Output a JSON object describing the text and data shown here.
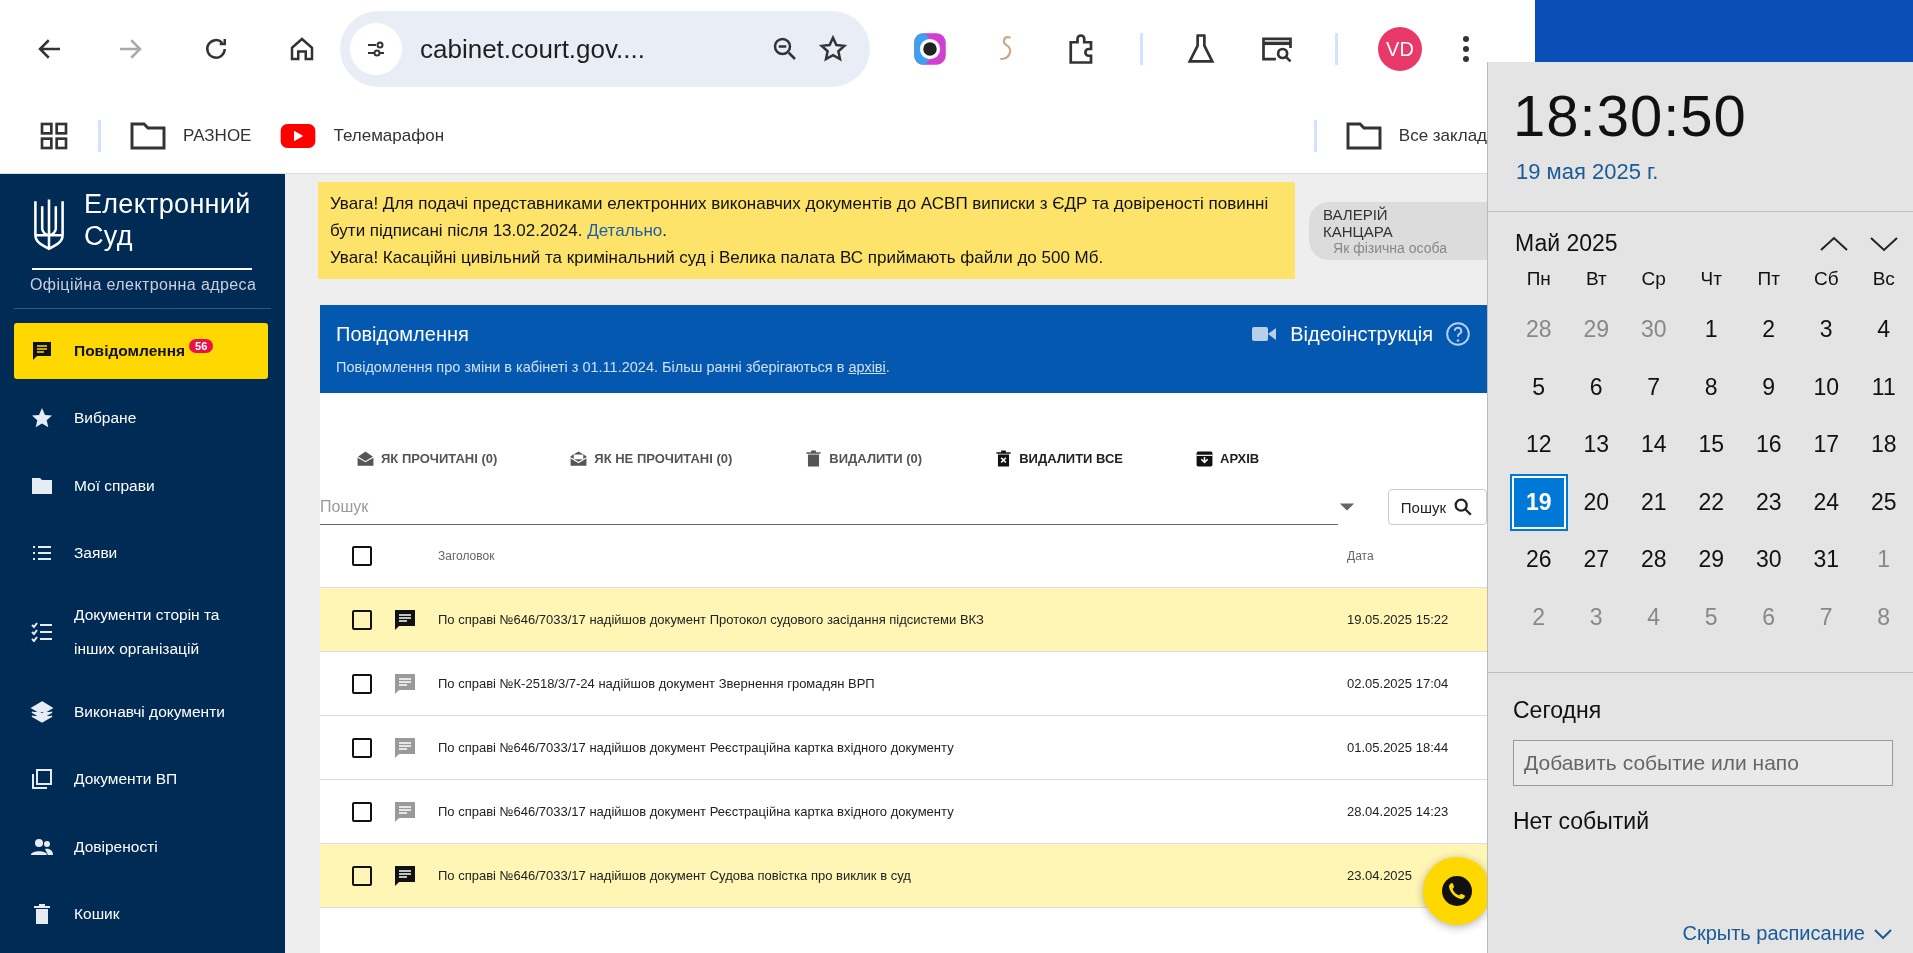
{
  "browser": {
    "url": "cabinet.court.gov....",
    "profile_initials": "VD",
    "bookmarks": [
      {
        "label": "РАЗНОЕ",
        "kind": "folder"
      },
      {
        "label": "Телемарафон",
        "kind": "video"
      }
    ],
    "all_bookmarks": "Все заклад"
  },
  "sidebar": {
    "logo_title": "Електронний Суд",
    "logo_subtitle": "Офіційна електронна адреса",
    "items": [
      {
        "label": "Повідомлення",
        "selected": true,
        "badge": "56"
      },
      {
        "label": "Вибране",
        "selected": false
      },
      {
        "label": "Мої справи",
        "selected": false
      },
      {
        "label": "Заяви",
        "selected": false
      },
      {
        "label": "Документи сторін та інших організацій",
        "selected": false
      },
      {
        "label": "Виконавчі документи",
        "selected": false
      },
      {
        "label": "Документи ВП",
        "selected": false
      },
      {
        "label": "Довіреності",
        "selected": false
      },
      {
        "label": "Кошик",
        "selected": false
      }
    ]
  },
  "notice": {
    "text_1": "Увага! Для подачі представниками електронних виконавчих документів до АСВП виписки з ЄДР та довіреності повинні бути підписані після 13.02.2024.",
    "link": "Детально",
    "after_link": ".",
    "text_2": "Увага! Касаційні цивільний та кримінальний суд і Велика палата ВС приймають файли до 500 Мб."
  },
  "user": {
    "name": "ВАЛЕРІЙ КАНЦАРА",
    "role": "Як фізична особа"
  },
  "messages_header": {
    "title": "Повідомлення",
    "subtitle": "Повідомлення про зміни в кабінеті з 01.11.2024. Більш ранні зберігаються в",
    "subtitle_link": "архіві",
    "after_link": ".",
    "video_label": "Відеоінструкція"
  },
  "actions": [
    {
      "label": "ЯК ПРОЧИТАНІ (0)",
      "kind": "read",
      "disabled": true
    },
    {
      "label": "ЯК НЕ ПРОЧИТАНІ (0)",
      "kind": "unread",
      "disabled": true
    },
    {
      "label": "ВИДАЛИТИ (0)",
      "kind": "delete",
      "disabled": true
    },
    {
      "label": "ВИДАЛИТИ ВСЕ",
      "kind": "delete_all",
      "disabled": false
    },
    {
      "label": "АРХІВ",
      "kind": "archive",
      "disabled": false
    }
  ],
  "search": {
    "placeholder": "Пошук",
    "button": "Пошук"
  },
  "table": {
    "columns": [
      "Заголовок",
      "Дата"
    ],
    "select_all_checked": false,
    "rows": [
      {
        "title": "По справі №646/7033/17 надійшов документ Протокол судового засідання підсистеми ВКЗ",
        "date": "19.05.2025 15:22",
        "unread": true,
        "checked": false
      },
      {
        "title": "По справі №К-2518/3/7-24 надійшов документ Звернення громадян ВРП",
        "date": "02.05.2025 17:04",
        "unread": false,
        "checked": false
      },
      {
        "title": "По справі №646/7033/17 надійшов документ Реєстраційна картка вхідного документу",
        "date": "01.05.2025 18:44",
        "unread": false,
        "checked": false
      },
      {
        "title": "По справі №646/7033/17 надійшов документ Реєстраційна картка вхідного документу",
        "date": "28.04.2025 14:23",
        "unread": false,
        "checked": false
      },
      {
        "title": "По справі №646/7033/17 надійшов документ Судова повістка про виклик в суд",
        "date": "23.04.2025",
        "unread": true,
        "checked": false
      }
    ]
  },
  "calendar": {
    "time": "18:30:50",
    "date": "19 мая 2025 г.",
    "month": "Май 2025",
    "weekdays": [
      "Пн",
      "Вт",
      "Ср",
      "Чт",
      "Пт",
      "Сб",
      "Вс"
    ],
    "weeks": [
      [
        {
          "label": "28",
          "other_month": true,
          "selected": false
        },
        {
          "label": "29",
          "other_month": true,
          "selected": false
        },
        {
          "label": "30",
          "other_month": true,
          "selected": false
        },
        {
          "label": "1",
          "other_month": false,
          "selected": false
        },
        {
          "label": "2",
          "other_month": false,
          "selected": false
        },
        {
          "label": "3",
          "other_month": false,
          "selected": false
        },
        {
          "label": "4",
          "other_month": false,
          "selected": false
        }
      ],
      [
        {
          "label": "5",
          "other_month": false,
          "selected": false
        },
        {
          "label": "6",
          "other_month": false,
          "selected": false
        },
        {
          "label": "7",
          "other_month": false,
          "selected": false
        },
        {
          "label": "8",
          "other_month": false,
          "selected": false
        },
        {
          "label": "9",
          "other_month": false,
          "selected": false
        },
        {
          "label": "10",
          "other_month": false,
          "selected": false
        },
        {
          "label": "11",
          "other_month": false,
          "selected": false
        }
      ],
      [
        {
          "label": "12",
          "other_month": false,
          "selected": false
        },
        {
          "label": "13",
          "other_month": false,
          "selected": false
        },
        {
          "label": "14",
          "other_month": false,
          "selected": false
        },
        {
          "label": "15",
          "other_month": false,
          "selected": false
        },
        {
          "label": "16",
          "other_month": false,
          "selected": false
        },
        {
          "label": "17",
          "other_month": false,
          "selected": false
        },
        {
          "label": "18",
          "other_month": false,
          "selected": false
        }
      ],
      [
        {
          "label": "19",
          "other_month": false,
          "selected": true
        },
        {
          "label": "20",
          "other_month": false,
          "selected": false
        },
        {
          "label": "21",
          "other_month": false,
          "selected": false
        },
        {
          "label": "22",
          "other_month": false,
          "selected": false
        },
        {
          "label": "23",
          "other_month": false,
          "selected": false
        },
        {
          "label": "24",
          "other_month": false,
          "selected": false
        },
        {
          "label": "25",
          "other_month": false,
          "selected": false
        }
      ],
      [
        {
          "label": "26",
          "other_month": false,
          "selected": false
        },
        {
          "label": "27",
          "other_month": false,
          "selected": false
        },
        {
          "label": "28",
          "other_month": false,
          "selected": false
        },
        {
          "label": "29",
          "other_month": false,
          "selected": false
        },
        {
          "label": "30",
          "other_month": false,
          "selected": false
        },
        {
          "label": "31",
          "other_month": false,
          "selected": false
        },
        {
          "label": "1",
          "other_month": true,
          "selected": false
        }
      ],
      [
        {
          "label": "2",
          "other_month": true,
          "selected": false
        },
        {
          "label": "3",
          "other_month": true,
          "selected": false
        },
        {
          "label": "4",
          "other_month": true,
          "selected": false
        },
        {
          "label": "5",
          "other_month": true,
          "selected": false
        },
        {
          "label": "6",
          "other_month": true,
          "selected": false
        },
        {
          "label": "7",
          "other_month": true,
          "selected": false
        },
        {
          "label": "8",
          "other_month": true,
          "selected": false
        }
      ]
    ],
    "today_label": "Сегодня",
    "event_placeholder": "Добавить событие или напо",
    "no_events": "Нет событий",
    "hide_schedule": "Скрыть расписание"
  }
}
